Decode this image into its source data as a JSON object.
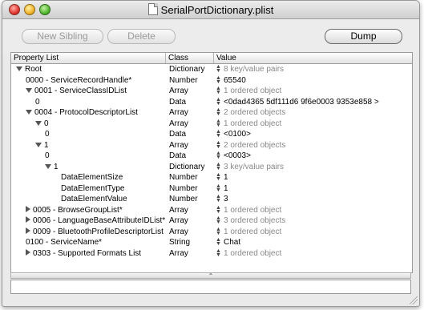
{
  "window": {
    "title": "SerialPortDictionary.plist"
  },
  "toolbar": {
    "new_sibling": "New Sibling",
    "delete": "Delete",
    "dump": "Dump"
  },
  "table": {
    "headers": {
      "name": "Property List",
      "class": "Class",
      "value": "Value"
    },
    "rows": [
      {
        "name": "Root",
        "class": "Dictionary",
        "value": "8 key/value pairs",
        "disclosure": "down",
        "indent": 0,
        "muted": true
      },
      {
        "name": "0000 - ServiceRecordHandle*",
        "class": "Number",
        "value": "65540",
        "disclosure": "",
        "indent": 1,
        "muted": false
      },
      {
        "name": "0001 - ServiceClassIDList",
        "class": "Array",
        "value": "1 ordered object",
        "disclosure": "down",
        "indent": 1,
        "muted": true
      },
      {
        "name": "0",
        "class": "Data",
        "value": "<0dad4365 5df111d6 9f6e0003 9353e858 >",
        "disclosure": "",
        "indent": 2,
        "muted": false
      },
      {
        "name": "0004 - ProtocolDescriptorList",
        "class": "Array",
        "value": "2 ordered objects",
        "disclosure": "down",
        "indent": 1,
        "muted": true
      },
      {
        "name": "0",
        "class": "Array",
        "value": "1 ordered object",
        "disclosure": "down",
        "indent": 2,
        "muted": true
      },
      {
        "name": "0",
        "class": "Data",
        "value": "<0100>",
        "disclosure": "",
        "indent": 3,
        "muted": false
      },
      {
        "name": "1",
        "class": "Array",
        "value": "2 ordered objects",
        "disclosure": "down",
        "indent": 2,
        "muted": true
      },
      {
        "name": "0",
        "class": "Data",
        "value": "<0003>",
        "disclosure": "",
        "indent": 3,
        "muted": false
      },
      {
        "name": "1",
        "class": "Dictionary",
        "value": "3 key/value pairs",
        "disclosure": "down",
        "indent": 3,
        "muted": true
      },
      {
        "name": "DataElementSize",
        "class": "Number",
        "value": "1",
        "disclosure": "",
        "indent": 4,
        "muted": false
      },
      {
        "name": "DataElementType",
        "class": "Number",
        "value": "1",
        "disclosure": "",
        "indent": 4,
        "muted": false
      },
      {
        "name": "DataElementValue",
        "class": "Number",
        "value": "3",
        "disclosure": "",
        "indent": 4,
        "muted": false
      },
      {
        "name": "0005 - BrowseGroupList*",
        "class": "Array",
        "value": "1 ordered object",
        "disclosure": "right",
        "indent": 1,
        "muted": true
      },
      {
        "name": "0006 - LanguageBaseAttributeIDList*",
        "class": "Array",
        "value": "3 ordered objects",
        "disclosure": "right",
        "indent": 1,
        "muted": true
      },
      {
        "name": "0009 - BluetoothProfileDescriptorList",
        "class": "Array",
        "value": "1 ordered object",
        "disclosure": "right",
        "indent": 1,
        "muted": true
      },
      {
        "name": "0100 - ServiceName*",
        "class": "String",
        "value": "Chat",
        "disclosure": "",
        "indent": 1,
        "muted": false
      },
      {
        "name": "0303 - Supported Formats List",
        "class": "Array",
        "value": "1 ordered object",
        "disclosure": "right",
        "indent": 1,
        "muted": true
      }
    ]
  }
}
